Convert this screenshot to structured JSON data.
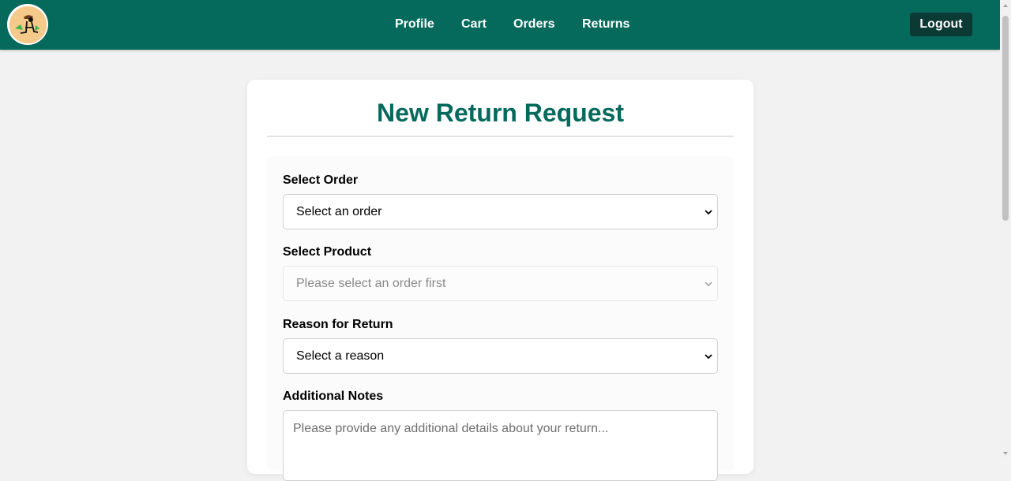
{
  "header": {
    "logo_icon": "avatar-logo-icon",
    "nav": [
      {
        "label": "Profile"
      },
      {
        "label": "Cart"
      },
      {
        "label": "Orders"
      },
      {
        "label": "Returns"
      }
    ],
    "logout_label": "Logout",
    "colors": {
      "bar": "#05695c",
      "logout_bg": "#0b3a34"
    }
  },
  "form": {
    "title": "New Return Request",
    "order": {
      "label": "Select Order",
      "value": "Select an order"
    },
    "product": {
      "label": "Select Product",
      "value": "Please select an order first",
      "disabled": true
    },
    "reason": {
      "label": "Reason for Return",
      "value": "Select a reason"
    },
    "notes": {
      "label": "Additional Notes",
      "placeholder": "Please provide any additional details about your return..."
    }
  }
}
